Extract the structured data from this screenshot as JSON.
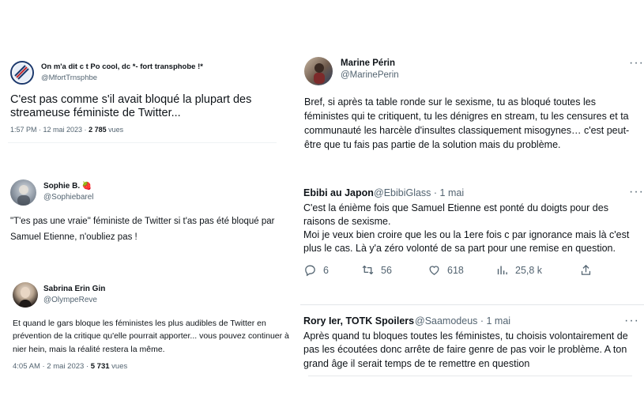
{
  "t1": {
    "name": "On m'a dit c t Po cool, dc *- fort transphobe !*",
    "handle": "@MfortTrnsphbe",
    "text": "C'est pas comme s'il avait bloqué la plupart des streameuse féministe de Twitter...",
    "time": "1:57 PM · 12 mai 2023 · ",
    "views": "2 785",
    "views_label": " vues"
  },
  "t2": {
    "name": "Marine Périn",
    "handle": "@MarinePerin",
    "more": "···",
    "text": "Bref, si après ta table ronde sur le sexisme, tu as bloqué toutes les féministes qui te critiquent, tu les dénigres en stream, tu les censures et ta communauté les harcèle d'insultes classiquement misogynes… c'est peut-être que tu fais pas partie de la solution mais du problème."
  },
  "t3": {
    "name": "Sophie B. 🍓",
    "handle": "@Sophiebarel",
    "text": "\"T'es pas une vraie\" féministe de Twitter si t'as pas été bloqué par Samuel Etienne, n'oubliez pas !"
  },
  "t4": {
    "name": "Ebibi au Japon",
    "handle_time": "@EbibiGlass · 1 mai",
    "more": "···",
    "text1": "C'est la énième fois que Samuel Etienne est ponté du doigts pour des raisons de sexisme.",
    "text2": "Moi je veux bien croire que les ou la 1ere fois c par ignorance mais là c'est plus le cas. Là y'a zéro volonté de sa part pour une remise en question.",
    "replies": "6",
    "retweets": "56",
    "likes": "618",
    "views": "25,8 k"
  },
  "t5": {
    "name": "Sabrina Erin Gin",
    "handle": "@OlympeReve",
    "text": "Et quand le gars bloque les féministes les plus audibles de Twitter en prévention de la critique qu'elle pourrait apporter... vous pouvez continuer à nier hein, mais la réalité restera la même.",
    "time": "4:05 AM · 2 mai 2023 · ",
    "views": "5 731",
    "views_label": " vues"
  },
  "t6": {
    "name": "Rory Ier, TOTK Spoilers",
    "handle_time": "@Saamodeus · 1 mai",
    "more": "···",
    "text": "Après quand tu bloques toutes les féministes, tu choisis volontairement de pas les écoutées donc arrête de faire genre de pas voir le problème. A ton grand âge il serait temps de te remettre en question"
  },
  "colors": {
    "text": "#0f1419",
    "muted": "#536471",
    "divider": "#eff3f4"
  }
}
